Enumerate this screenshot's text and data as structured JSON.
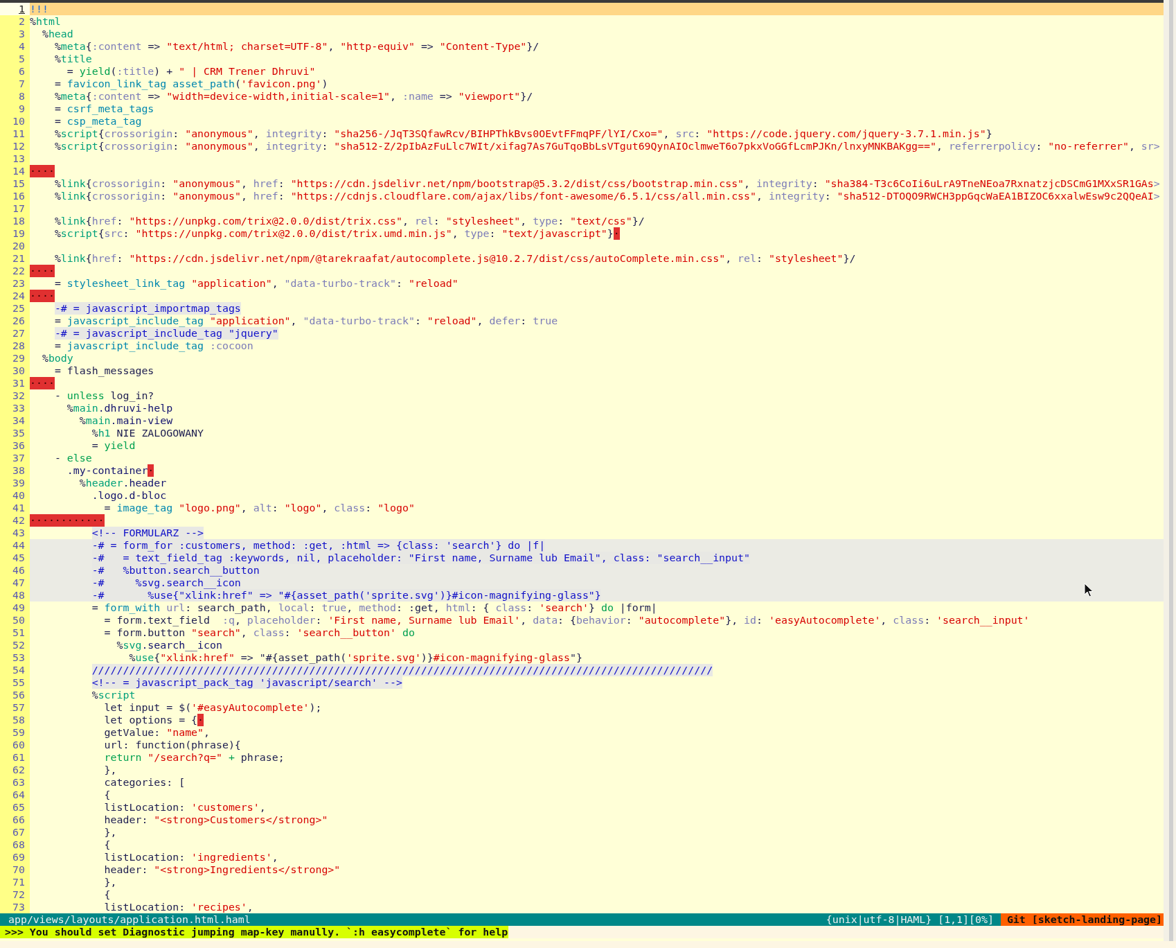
{
  "editor": {
    "lines": [
      {
        "number": "1",
        "current": true,
        "shaded": false,
        "segments": [
          {
            "kind": "doctype",
            "text": "!!!"
          }
        ]
      },
      {
        "number": "2",
        "current": false,
        "shaded": false,
        "segments": [
          {
            "kind": "plain",
            "text": "%"
          },
          {
            "kind": "tag",
            "text": "html"
          }
        ]
      },
      {
        "number": "3",
        "current": false,
        "shaded": false,
        "segments": [
          {
            "kind": "plain",
            "text": "  %"
          },
          {
            "kind": "tag",
            "text": "head"
          }
        ]
      },
      {
        "number": "4",
        "current": false,
        "shaded": false,
        "segments": [
          {
            "kind": "plain",
            "text": "    %"
          },
          {
            "kind": "tag",
            "text": "meta"
          },
          {
            "kind": "plain",
            "text": "{"
          },
          {
            "kind": "attr",
            "text": ":content"
          },
          {
            "kind": "plain",
            "text": " => "
          },
          {
            "kind": "string",
            "text": "\"text/html; charset=UTF-8\""
          },
          {
            "kind": "plain",
            "text": ", "
          },
          {
            "kind": "string",
            "text": "\"http-equiv\""
          },
          {
            "kind": "plain",
            "text": " => "
          },
          {
            "kind": "string",
            "text": "\"Content-Type\""
          },
          {
            "kind": "plain",
            "text": "}/"
          }
        ]
      },
      {
        "number": "5",
        "current": false,
        "shaded": false,
        "segments": [
          {
            "kind": "plain",
            "text": "    %"
          },
          {
            "kind": "tag",
            "text": "title"
          }
        ]
      },
      {
        "number": "6",
        "current": false,
        "shaded": false,
        "segments": [
          {
            "kind": "plain",
            "text": "      = "
          },
          {
            "kind": "keyword",
            "text": "yield"
          },
          {
            "kind": "plain",
            "text": "("
          },
          {
            "kind": "attr",
            "text": ":title"
          },
          {
            "kind": "plain",
            "text": ") + "
          },
          {
            "kind": "string",
            "text": "\" | CRM Trener Dhruvi\""
          }
        ]
      },
      {
        "number": "7",
        "current": false,
        "shaded": false,
        "segments": [
          {
            "kind": "plain",
            "text": "    = "
          },
          {
            "kind": "helper",
            "text": "favicon_link_tag asset_path"
          },
          {
            "kind": "plain",
            "text": "("
          },
          {
            "kind": "string",
            "text": "'favicon.png'"
          },
          {
            "kind": "plain",
            "text": ")"
          }
        ]
      },
      {
        "number": "8",
        "current": false,
        "shaded": false,
        "segments": [
          {
            "kind": "plain",
            "text": "    %"
          },
          {
            "kind": "tag",
            "text": "meta"
          },
          {
            "kind": "plain",
            "text": "{"
          },
          {
            "kind": "attr",
            "text": ":content"
          },
          {
            "kind": "plain",
            "text": " => "
          },
          {
            "kind": "string",
            "text": "\"width=device-width,initial-scale=1\""
          },
          {
            "kind": "plain",
            "text": ", "
          },
          {
            "kind": "attr",
            "text": ":name"
          },
          {
            "kind": "plain",
            "text": " => "
          },
          {
            "kind": "string",
            "text": "\"viewport\""
          },
          {
            "kind": "plain",
            "text": "}/"
          }
        ]
      },
      {
        "number": "9",
        "current": false,
        "shaded": false,
        "segments": [
          {
            "kind": "plain",
            "text": "    = "
          },
          {
            "kind": "helper",
            "text": "csrf_meta_tags"
          }
        ]
      },
      {
        "number": "10",
        "current": false,
        "shaded": false,
        "segments": [
          {
            "kind": "plain",
            "text": "    = "
          },
          {
            "kind": "helper",
            "text": "csp_meta_tag"
          }
        ]
      },
      {
        "number": "11",
        "current": false,
        "shaded": false,
        "segments": [
          {
            "kind": "plain",
            "text": "    %"
          },
          {
            "kind": "tag",
            "text": "script"
          },
          {
            "kind": "plain",
            "text": "{"
          },
          {
            "kind": "attr",
            "text": "crossorigin"
          },
          {
            "kind": "plain",
            "text": ": "
          },
          {
            "kind": "string",
            "text": "\"anonymous\""
          },
          {
            "kind": "plain",
            "text": ", "
          },
          {
            "kind": "attr",
            "text": "integrity"
          },
          {
            "kind": "plain",
            "text": ": "
          },
          {
            "kind": "string",
            "text": "\"sha256-/JqT3SQfawRcv/BIHPThkBvs0OEvtFFmqPF/lYI/Cxo=\""
          },
          {
            "kind": "plain",
            "text": ", "
          },
          {
            "kind": "attr",
            "text": "src"
          },
          {
            "kind": "plain",
            "text": ": "
          },
          {
            "kind": "string",
            "text": "\"https://code.jquery.com/jquery-3.7.1.min.js\""
          },
          {
            "kind": "plain",
            "text": "}"
          }
        ]
      },
      {
        "number": "12",
        "current": false,
        "shaded": false,
        "segments": [
          {
            "kind": "plain",
            "text": "    %"
          },
          {
            "kind": "tag",
            "text": "script"
          },
          {
            "kind": "plain",
            "text": "{"
          },
          {
            "kind": "attr",
            "text": "crossorigin"
          },
          {
            "kind": "plain",
            "text": ": "
          },
          {
            "kind": "string",
            "text": "\"anonymous\""
          },
          {
            "kind": "plain",
            "text": ", "
          },
          {
            "kind": "attr",
            "text": "integrity"
          },
          {
            "kind": "plain",
            "text": ": "
          },
          {
            "kind": "string",
            "text": "\"sha512-Z/2pIbAzFuLlc7WIt/xifag7As7GuTqoBbLsVTgut69QynAIOclmweT6o7pkxVoGGfLcmPJKn/lnxyMNKBAKgg==\""
          },
          {
            "kind": "plain",
            "text": ", "
          },
          {
            "kind": "attr",
            "text": "referrerpolicy"
          },
          {
            "kind": "plain",
            "text": ": "
          },
          {
            "kind": "string",
            "text": "\"no-referrer\""
          },
          {
            "kind": "plain",
            "text": ", "
          },
          {
            "kind": "attr",
            "text": "sr"
          },
          {
            "kind": "overflow",
            "text": ">"
          }
        ]
      },
      {
        "number": "13",
        "current": false,
        "shaded": false
      },
      {
        "number": "14",
        "current": false,
        "shaded": false,
        "segments": [
          {
            "kind": "trail",
            "text": "····"
          }
        ]
      },
      {
        "number": "15",
        "current": false,
        "shaded": false,
        "segments": [
          {
            "kind": "plain",
            "text": "    %"
          },
          {
            "kind": "tag",
            "text": "link"
          },
          {
            "kind": "plain",
            "text": "{"
          },
          {
            "kind": "attr",
            "text": "crossorigin"
          },
          {
            "kind": "plain",
            "text": ": "
          },
          {
            "kind": "string",
            "text": "\"anonymous\""
          },
          {
            "kind": "plain",
            "text": ", "
          },
          {
            "kind": "attr",
            "text": "href"
          },
          {
            "kind": "plain",
            "text": ": "
          },
          {
            "kind": "string",
            "text": "\"https://cdn.jsdelivr.net/npm/bootstrap@5.3.2/dist/css/bootstrap.min.css\""
          },
          {
            "kind": "plain",
            "text": ", "
          },
          {
            "kind": "attr",
            "text": "integrity"
          },
          {
            "kind": "plain",
            "text": ": "
          },
          {
            "kind": "string",
            "text": "\"sha384-T3c6CoIi6uLrA9TneNEoa7RxnatzjcDSCmG1MXxSR1GAs"
          },
          {
            "kind": "overflow",
            "text": ">"
          }
        ]
      },
      {
        "number": "16",
        "current": false,
        "shaded": false,
        "segments": [
          {
            "kind": "plain",
            "text": "    %"
          },
          {
            "kind": "tag",
            "text": "link"
          },
          {
            "kind": "plain",
            "text": "{"
          },
          {
            "kind": "attr",
            "text": "crossorigin"
          },
          {
            "kind": "plain",
            "text": ": "
          },
          {
            "kind": "string",
            "text": "\"anonymous\""
          },
          {
            "kind": "plain",
            "text": ", "
          },
          {
            "kind": "attr",
            "text": "href"
          },
          {
            "kind": "plain",
            "text": ": "
          },
          {
            "kind": "string",
            "text": "\"https://cdnjs.cloudflare.com/ajax/libs/font-awesome/6.5.1/css/all.min.css\""
          },
          {
            "kind": "plain",
            "text": ", "
          },
          {
            "kind": "attr",
            "text": "integrity"
          },
          {
            "kind": "plain",
            "text": ": "
          },
          {
            "kind": "string",
            "text": "\"sha512-DTOQO9RWCH3ppGqcWaEA1BIZOC6xxalwEsw9c2QQeAI"
          },
          {
            "kind": "overflow",
            "text": ">"
          }
        ]
      },
      {
        "number": "17",
        "current": false,
        "shaded": false
      },
      {
        "number": "18",
        "current": false,
        "shaded": false,
        "segments": [
          {
            "kind": "plain",
            "text": "    %"
          },
          {
            "kind": "tag",
            "text": "link"
          },
          {
            "kind": "plain",
            "text": "{"
          },
          {
            "kind": "attr",
            "text": "href"
          },
          {
            "kind": "plain",
            "text": ": "
          },
          {
            "kind": "string",
            "text": "\"https://unpkg.com/trix@2.0.0/dist/trix.css\""
          },
          {
            "kind": "plain",
            "text": ", "
          },
          {
            "kind": "attr",
            "text": "rel"
          },
          {
            "kind": "plain",
            "text": ": "
          },
          {
            "kind": "string",
            "text": "\"stylesheet\""
          },
          {
            "kind": "plain",
            "text": ", "
          },
          {
            "kind": "attr",
            "text": "type"
          },
          {
            "kind": "plain",
            "text": ": "
          },
          {
            "kind": "string",
            "text": "\"text/css\""
          },
          {
            "kind": "plain",
            "text": "}/"
          }
        ]
      },
      {
        "number": "19",
        "current": false,
        "shaded": false,
        "segments": [
          {
            "kind": "plain",
            "text": "    %"
          },
          {
            "kind": "tag",
            "text": "script"
          },
          {
            "kind": "plain",
            "text": "{"
          },
          {
            "kind": "attr",
            "text": "src"
          },
          {
            "kind": "plain",
            "text": ": "
          },
          {
            "kind": "string",
            "text": "\"https://unpkg.com/trix@2.0.0/dist/trix.umd.min.js\""
          },
          {
            "kind": "plain",
            "text": ", "
          },
          {
            "kind": "attr",
            "text": "type"
          },
          {
            "kind": "plain",
            "text": ": "
          },
          {
            "kind": "string",
            "text": "\"text/javascript\""
          },
          {
            "kind": "plain",
            "text": "}"
          },
          {
            "kind": "trail",
            "text": "·"
          }
        ]
      },
      {
        "number": "20",
        "current": false,
        "shaded": false
      },
      {
        "number": "21",
        "current": false,
        "shaded": false,
        "segments": [
          {
            "kind": "plain",
            "text": "    %"
          },
          {
            "kind": "tag",
            "text": "link"
          },
          {
            "kind": "plain",
            "text": "{"
          },
          {
            "kind": "attr",
            "text": "href"
          },
          {
            "kind": "plain",
            "text": ": "
          },
          {
            "kind": "string",
            "text": "\"https://cdn.jsdelivr.net/npm/@tarekraafat/autocomplete.js@10.2.7/dist/css/autoComplete.min.css\""
          },
          {
            "kind": "plain",
            "text": ", "
          },
          {
            "kind": "attr",
            "text": "rel"
          },
          {
            "kind": "plain",
            "text": ": "
          },
          {
            "kind": "string",
            "text": "\"stylesheet\""
          },
          {
            "kind": "plain",
            "text": "}/"
          }
        ]
      },
      {
        "number": "22",
        "current": false,
        "shaded": false,
        "segments": [
          {
            "kind": "trail",
            "text": "····"
          }
        ]
      },
      {
        "number": "23",
        "current": false,
        "shaded": false,
        "segments": [
          {
            "kind": "plain",
            "text": "    = "
          },
          {
            "kind": "helper",
            "text": "stylesheet_link_tag "
          },
          {
            "kind": "string",
            "text": "\"application\""
          },
          {
            "kind": "plain",
            "text": ", "
          },
          {
            "kind": "attr",
            "text": "\"data-turbo-track\""
          },
          {
            "kind": "plain",
            "text": ": "
          },
          {
            "kind": "string",
            "text": "\"reload\""
          }
        ]
      },
      {
        "number": "24",
        "current": false,
        "shaded": false,
        "segments": [
          {
            "kind": "trail",
            "text": "····"
          }
        ]
      },
      {
        "number": "25",
        "current": false,
        "shaded": false,
        "segments": [
          {
            "kind": "comment",
            "text": "    -# = javascript_importmap_tags"
          }
        ]
      },
      {
        "number": "26",
        "current": false,
        "shaded": false,
        "segments": [
          {
            "kind": "plain",
            "text": "    = "
          },
          {
            "kind": "helper",
            "text": "javascript_include_tag "
          },
          {
            "kind": "string",
            "text": "\"application\""
          },
          {
            "kind": "plain",
            "text": ", "
          },
          {
            "kind": "attr",
            "text": "\"data-turbo-track\""
          },
          {
            "kind": "plain",
            "text": ": "
          },
          {
            "kind": "string",
            "text": "\"reload\""
          },
          {
            "kind": "plain",
            "text": ", "
          },
          {
            "kind": "attr",
            "text": "defer"
          },
          {
            "kind": "plain",
            "text": ": "
          },
          {
            "kind": "attr",
            "text": "true"
          }
        ]
      },
      {
        "number": "27",
        "current": false,
        "shaded": false,
        "segments": [
          {
            "kind": "comment",
            "text": "    -# = javascript_include_tag \"jquery\""
          }
        ]
      },
      {
        "number": "28",
        "current": false,
        "shaded": false,
        "segments": [
          {
            "kind": "plain",
            "text": "    = "
          },
          {
            "kind": "helper",
            "text": "javascript_include_tag "
          },
          {
            "kind": "attr",
            "text": ":cocoon"
          }
        ]
      },
      {
        "number": "29",
        "current": false,
        "shaded": false,
        "segments": [
          {
            "kind": "plain",
            "text": "  %"
          },
          {
            "kind": "tag",
            "text": "body"
          }
        ]
      },
      {
        "number": "30",
        "current": false,
        "shaded": false,
        "segments": [
          {
            "kind": "plain",
            "text": "    = flash_messages"
          }
        ]
      },
      {
        "number": "31",
        "current": false,
        "shaded": false,
        "segments": [
          {
            "kind": "trail",
            "text": "····"
          }
        ]
      },
      {
        "number": "32",
        "current": false,
        "shaded": false,
        "segments": [
          {
            "kind": "plain",
            "text": "    - "
          },
          {
            "kind": "keyword",
            "text": "unless"
          },
          {
            "kind": "plain",
            "text": " log_in?"
          }
        ]
      },
      {
        "number": "33",
        "current": false,
        "shaded": false,
        "segments": [
          {
            "kind": "plain",
            "text": "      %"
          },
          {
            "kind": "tag",
            "text": "main"
          },
          {
            "kind": "classname",
            "text": ".dhruvi-help"
          }
        ]
      },
      {
        "number": "34",
        "current": false,
        "shaded": false,
        "segments": [
          {
            "kind": "plain",
            "text": "        %"
          },
          {
            "kind": "tag",
            "text": "main"
          },
          {
            "kind": "classname",
            "text": ".main-view"
          }
        ]
      },
      {
        "number": "35",
        "current": false,
        "shaded": false,
        "segments": [
          {
            "kind": "plain",
            "text": "          %"
          },
          {
            "kind": "tag",
            "text": "h1"
          },
          {
            "kind": "plain",
            "text": " NIE ZALOGOWANY"
          }
        ]
      },
      {
        "number": "36",
        "current": false,
        "shaded": false,
        "segments": [
          {
            "kind": "plain",
            "text": "          = "
          },
          {
            "kind": "keyword",
            "text": "yield"
          }
        ]
      },
      {
        "number": "37",
        "current": false,
        "shaded": false,
        "segments": [
          {
            "kind": "plain",
            "text": "    - "
          },
          {
            "kind": "keyword",
            "text": "else"
          }
        ]
      },
      {
        "number": "38",
        "current": false,
        "shaded": false,
        "segments": [
          {
            "kind": "classname",
            "text": "      .my-container"
          },
          {
            "kind": "trail",
            "text": "·"
          }
        ]
      },
      {
        "number": "39",
        "current": false,
        "shaded": false,
        "segments": [
          {
            "kind": "plain",
            "text": "        %"
          },
          {
            "kind": "tag",
            "text": "header"
          },
          {
            "kind": "classname",
            "text": ".header"
          }
        ]
      },
      {
        "number": "40",
        "current": false,
        "shaded": false,
        "segments": [
          {
            "kind": "classname",
            "text": "          .logo.d-bloc"
          }
        ]
      },
      {
        "number": "41",
        "current": false,
        "shaded": false,
        "segments": [
          {
            "kind": "plain",
            "text": "            = "
          },
          {
            "kind": "helper",
            "text": "image_tag "
          },
          {
            "kind": "string",
            "text": "\"logo.png\""
          },
          {
            "kind": "plain",
            "text": ", "
          },
          {
            "kind": "attr",
            "text": "alt"
          },
          {
            "kind": "plain",
            "text": ": "
          },
          {
            "kind": "string",
            "text": "\"logo\""
          },
          {
            "kind": "plain",
            "text": ", "
          },
          {
            "kind": "attr",
            "text": "class"
          },
          {
            "kind": "plain",
            "text": ": "
          },
          {
            "kind": "string",
            "text": "\"logo\""
          }
        ]
      },
      {
        "number": "42",
        "current": false,
        "shaded": false,
        "segments": [
          {
            "kind": "trail",
            "text": "············"
          }
        ]
      },
      {
        "number": "43",
        "current": false,
        "shaded": false,
        "segments": [
          {
            "kind": "comment",
            "text": "          <!-- FORMULARZ -->"
          }
        ]
      },
      {
        "number": "44",
        "current": false,
        "shaded": true,
        "segments": [
          {
            "kind": "comment",
            "text": "          -# = form_for :customers, method: :get, :html => {class: 'search'} do |f|"
          }
        ]
      },
      {
        "number": "45",
        "current": false,
        "shaded": true,
        "segments": [
          {
            "kind": "comment",
            "text": "          -#   = text_field_tag :keywords, nil, placeholder: \"First name, Surname lub Email\", class: \"search__input\""
          }
        ]
      },
      {
        "number": "46",
        "current": false,
        "shaded": true,
        "segments": [
          {
            "kind": "comment",
            "text": "          -#   %button.search__button"
          }
        ]
      },
      {
        "number": "47",
        "current": false,
        "shaded": true,
        "segments": [
          {
            "kind": "comment",
            "text": "          -#     %svg.search__icon"
          }
        ]
      },
      {
        "number": "48",
        "current": false,
        "shaded": true,
        "segments": [
          {
            "kind": "comment",
            "text": "          -#       %use{\"xlink:href\" => \"#{asset_path('sprite.svg')}#icon-magnifying-glass\"}"
          }
        ]
      },
      {
        "number": "49",
        "current": false,
        "shaded": false,
        "segments": [
          {
            "kind": "plain",
            "text": "          = "
          },
          {
            "kind": "helper",
            "text": "form_with "
          },
          {
            "kind": "attr",
            "text": "url"
          },
          {
            "kind": "plain",
            "text": ": search_path, "
          },
          {
            "kind": "attr",
            "text": "local"
          },
          {
            "kind": "plain",
            "text": ": "
          },
          {
            "kind": "attr",
            "text": "true"
          },
          {
            "kind": "plain",
            "text": ", "
          },
          {
            "kind": "attr",
            "text": "method"
          },
          {
            "kind": "plain",
            "text": ": :get, "
          },
          {
            "kind": "attr",
            "text": "html"
          },
          {
            "kind": "plain",
            "text": ": { "
          },
          {
            "kind": "attr",
            "text": "class"
          },
          {
            "kind": "plain",
            "text": ": "
          },
          {
            "kind": "string",
            "text": "'search'"
          },
          {
            "kind": "plain",
            "text": "} "
          },
          {
            "kind": "keyword",
            "text": "do"
          },
          {
            "kind": "plain",
            "text": " |form|"
          }
        ]
      },
      {
        "number": "50",
        "current": false,
        "shaded": false,
        "segments": [
          {
            "kind": "plain",
            "text": "            = form.text_field  "
          },
          {
            "kind": "attr",
            "text": ":q"
          },
          {
            "kind": "plain",
            "text": ", "
          },
          {
            "kind": "attr",
            "text": "placeholder"
          },
          {
            "kind": "plain",
            "text": ": "
          },
          {
            "kind": "string",
            "text": "'First name, Surname lub Email'"
          },
          {
            "kind": "plain",
            "text": ", "
          },
          {
            "kind": "attr",
            "text": "data"
          },
          {
            "kind": "plain",
            "text": ": {"
          },
          {
            "kind": "attr",
            "text": "behavior"
          },
          {
            "kind": "plain",
            "text": ": "
          },
          {
            "kind": "string",
            "text": "\"autocomplete\""
          },
          {
            "kind": "plain",
            "text": "}, "
          },
          {
            "kind": "attr",
            "text": "id"
          },
          {
            "kind": "plain",
            "text": ": "
          },
          {
            "kind": "string",
            "text": "'easyAutocomplete'"
          },
          {
            "kind": "plain",
            "text": ", "
          },
          {
            "kind": "attr",
            "text": "class"
          },
          {
            "kind": "plain",
            "text": ": "
          },
          {
            "kind": "string",
            "text": "'search__input'"
          }
        ]
      },
      {
        "number": "51",
        "current": false,
        "shaded": false,
        "segments": [
          {
            "kind": "plain",
            "text": "            = form.button "
          },
          {
            "kind": "string",
            "text": "\"search\""
          },
          {
            "kind": "plain",
            "text": ", "
          },
          {
            "kind": "attr",
            "text": "class"
          },
          {
            "kind": "plain",
            "text": ": "
          },
          {
            "kind": "string",
            "text": "'search__button' "
          },
          {
            "kind": "keyword",
            "text": "do"
          }
        ]
      },
      {
        "number": "52",
        "current": false,
        "shaded": false,
        "segments": [
          {
            "kind": "plain",
            "text": "              %"
          },
          {
            "kind": "tag",
            "text": "svg"
          },
          {
            "kind": "classname",
            "text": ".search__icon"
          }
        ]
      },
      {
        "number": "53",
        "current": false,
        "shaded": false,
        "segments": [
          {
            "kind": "plain",
            "text": "                %"
          },
          {
            "kind": "tag",
            "text": "use"
          },
          {
            "kind": "plain",
            "text": "{"
          },
          {
            "kind": "string",
            "text": "\"xlink:href\""
          },
          {
            "kind": "plain",
            "text": " => \"#{asset_path("
          },
          {
            "kind": "string",
            "text": "'sprite.svg'"
          },
          {
            "kind": "plain",
            "text": ")}"
          },
          {
            "kind": "string",
            "text": "#icon-magnifying-glass"
          },
          {
            "kind": "plain",
            "text": "\"}"
          }
        ]
      },
      {
        "number": "54",
        "current": false,
        "shaded": false,
        "segments": [
          {
            "kind": "comment",
            "text": "          ////////////////////////////////////////////////////////////////////////////////////////////////////"
          }
        ]
      },
      {
        "number": "55",
        "current": false,
        "shaded": false,
        "segments": [
          {
            "kind": "comment",
            "text": "          <!-- = javascript_pack_tag 'javascript/search' -->"
          }
        ]
      },
      {
        "number": "56",
        "current": false,
        "shaded": false,
        "segments": [
          {
            "kind": "plain",
            "text": "          %"
          },
          {
            "kind": "tag",
            "text": "script"
          }
        ]
      },
      {
        "number": "57",
        "current": false,
        "shaded": false,
        "segments": [
          {
            "kind": "plain",
            "text": "            let input = $("
          },
          {
            "kind": "string",
            "text": "'#easyAutocomplete'"
          },
          {
            "kind": "plain",
            "text": ");"
          }
        ]
      },
      {
        "number": "58",
        "current": false,
        "shaded": false,
        "segments": [
          {
            "kind": "plain",
            "text": "            let options = {"
          },
          {
            "kind": "trail",
            "text": "·"
          }
        ]
      },
      {
        "number": "59",
        "current": false,
        "shaded": false,
        "segments": [
          {
            "kind": "plain",
            "text": "            getValue: "
          },
          {
            "kind": "string",
            "text": "\"name\""
          },
          {
            "kind": "plain",
            "text": ","
          }
        ]
      },
      {
        "number": "60",
        "current": false,
        "shaded": false,
        "segments": [
          {
            "kind": "plain",
            "text": "            url: function(phrase){"
          }
        ]
      },
      {
        "number": "61",
        "current": false,
        "shaded": false,
        "segments": [
          {
            "kind": "keyword",
            "text": "            return "
          },
          {
            "kind": "string",
            "text": "\"/search?q=\" "
          },
          {
            "kind": "keyword",
            "text": "+"
          },
          {
            "kind": "plain",
            "text": " phrase;"
          }
        ]
      },
      {
        "number": "62",
        "current": false,
        "shaded": false,
        "segments": [
          {
            "kind": "plain",
            "text": "            },"
          }
        ]
      },
      {
        "number": "63",
        "current": false,
        "shaded": false,
        "segments": [
          {
            "kind": "plain",
            "text": "            categories: ["
          }
        ]
      },
      {
        "number": "64",
        "current": false,
        "shaded": false,
        "segments": [
          {
            "kind": "plain",
            "text": "            {"
          }
        ]
      },
      {
        "number": "65",
        "current": false,
        "shaded": false,
        "segments": [
          {
            "kind": "plain",
            "text": "            listLocation: "
          },
          {
            "kind": "string",
            "text": "'customers'"
          },
          {
            "kind": "plain",
            "text": ","
          }
        ]
      },
      {
        "number": "66",
        "current": false,
        "shaded": false,
        "segments": [
          {
            "kind": "plain",
            "text": "            header: "
          },
          {
            "kind": "string",
            "text": "\"<strong>Customers</strong>\""
          }
        ]
      },
      {
        "number": "67",
        "current": false,
        "shaded": false,
        "segments": [
          {
            "kind": "plain",
            "text": "            },"
          }
        ]
      },
      {
        "number": "68",
        "current": false,
        "shaded": false,
        "segments": [
          {
            "kind": "plain",
            "text": "            {"
          }
        ]
      },
      {
        "number": "69",
        "current": false,
        "shaded": false,
        "segments": [
          {
            "kind": "plain",
            "text": "            listLocation: "
          },
          {
            "kind": "string",
            "text": "'ingredients'"
          },
          {
            "kind": "plain",
            "text": ","
          }
        ]
      },
      {
        "number": "70",
        "current": false,
        "shaded": false,
        "segments": [
          {
            "kind": "plain",
            "text": "            header: "
          },
          {
            "kind": "string",
            "text": "\"<strong>Ingredients</strong>\""
          }
        ]
      },
      {
        "number": "71",
        "current": false,
        "shaded": false,
        "segments": [
          {
            "kind": "plain",
            "text": "            },"
          }
        ]
      },
      {
        "number": "72",
        "current": false,
        "shaded": false,
        "segments": [
          {
            "kind": "plain",
            "text": "            {"
          }
        ]
      },
      {
        "number": "73",
        "current": false,
        "shaded": false,
        "segments": [
          {
            "kind": "plain",
            "text": "            listLocation: "
          },
          {
            "kind": "string",
            "text": "'recipes'"
          },
          {
            "kind": "plain",
            "text": ","
          }
        ]
      }
    ]
  },
  "status_bar": {
    "file_path": "app/views/layouts/application.html.haml",
    "file_info": "{unix|utf-8|HAML} [1,1][0%]",
    "git_branch": "Git [sketch-landing-page]"
  },
  "message": ">>> You should set Diagnostic jumping map-key manully. `:h easycomplete` for help"
}
